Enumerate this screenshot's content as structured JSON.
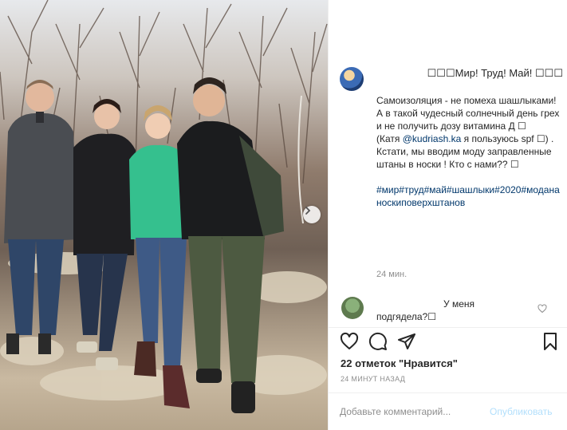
{
  "post": {
    "title": "☐☐☐Мир! Труд! Май! ☐☐☐",
    "caption": {
      "line1": "Самоизоляция - не помеха шашлыками!",
      "line2": "А в такой чудесный солнечный день грех и не получить дозу витамина Д ☐",
      "line3_pre": "(Катя ",
      "mention": "@kudriash.ka",
      "line3_post": " я пользуюсь spf ☐) .",
      "line4": "Кстати, мы вводим моду заправленные штаны в носки ! Кто с нами?? ☐",
      "hashtags": "#мир#труд#май#шашлыки#2020#модананоскиповерхштанов"
    },
    "time_ago": "24 мин."
  },
  "comment": {
    "text_line1": "У меня",
    "text_line2": "подгядела?☐"
  },
  "stats": {
    "likes": "22 отметок \"Нравится\"",
    "date": "24 МИНУТ НАЗАД"
  },
  "add_comment": {
    "placeholder": "Добавьте комментарий...",
    "publish": "Опубликовать"
  },
  "colors": {
    "link": "#00376b",
    "muted": "#8e8e8e",
    "publish_disabled": "#b2dffc"
  },
  "icons": [
    "heart-icon",
    "comment-icon",
    "share-icon",
    "bookmark-icon",
    "next-arrow-icon"
  ]
}
